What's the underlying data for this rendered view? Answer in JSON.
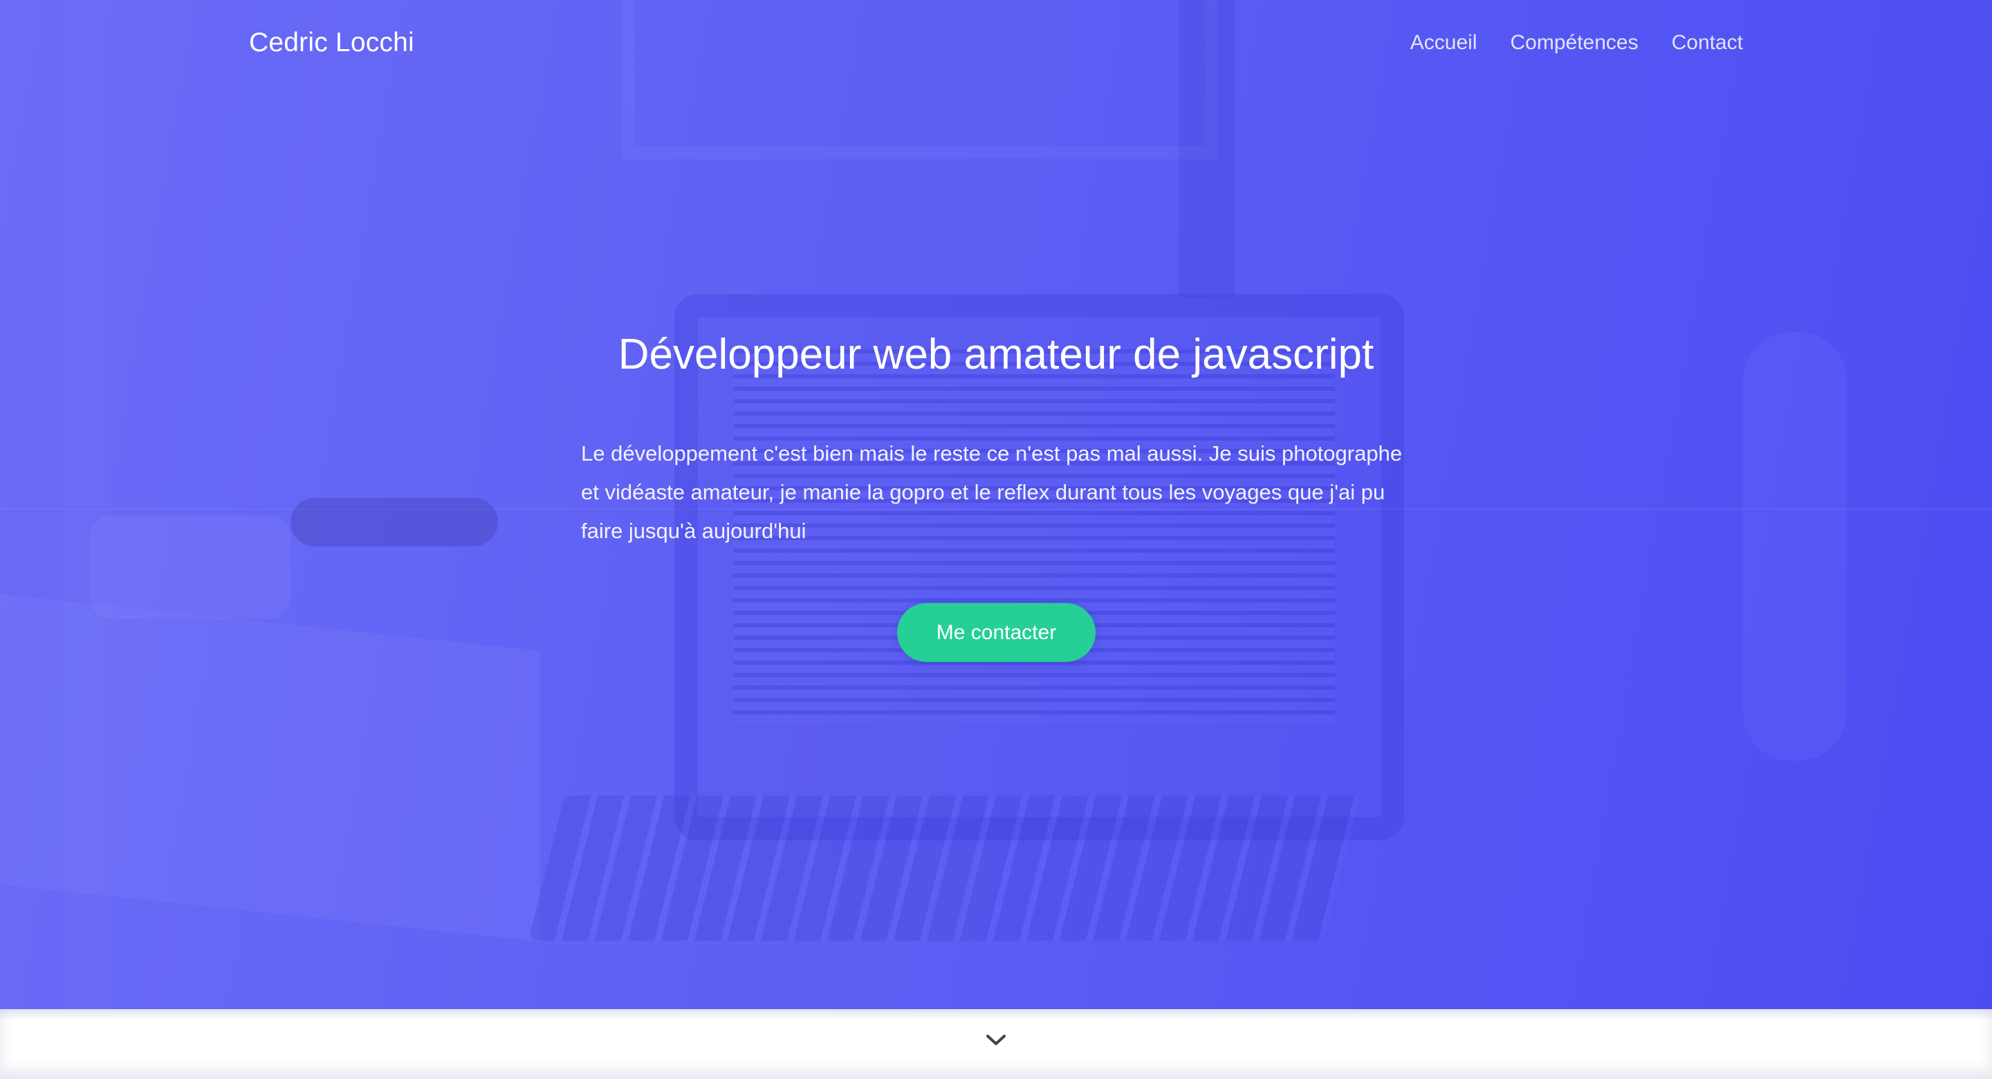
{
  "brand": {
    "name": "Cedric Locchi"
  },
  "nav": {
    "items": [
      {
        "label": "Accueil"
      },
      {
        "label": "Compétences"
      },
      {
        "label": "Contact"
      }
    ]
  },
  "hero": {
    "title": "Développeur web amateur de javascript",
    "text": "Le développement c'est bien mais le reste ce n'est pas mal aussi. Je suis photographe et vidéaste amateur, je manie la gopro et le reflex durant tous les voyages que j'ai pu faire jusqu'à aujourd'hui",
    "cta_label": "Me contacter"
  },
  "scroll": {
    "icon": "chevron-down-icon"
  },
  "colors": {
    "hero_start": "#6a6cf6",
    "hero_end": "#4b4df2",
    "cta": "#26cf95",
    "text": "#ffffff",
    "chevron": "#444444"
  }
}
